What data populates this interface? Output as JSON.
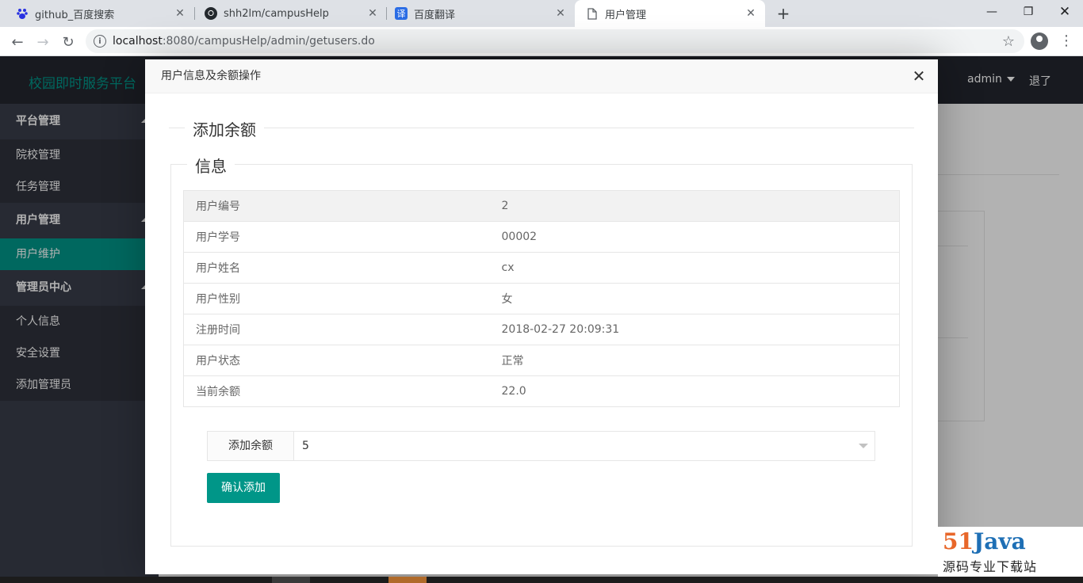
{
  "browser": {
    "tabs": [
      {
        "label": "github_百度搜索",
        "icon": "baidu-paw-icon"
      },
      {
        "label": "shh2lm/campusHelp",
        "icon": "github-icon"
      },
      {
        "label": "百度翻译",
        "icon": "translate-icon",
        "icon_text": "译"
      },
      {
        "label": "用户管理",
        "icon": "page-icon",
        "active": true
      }
    ],
    "url_host": "localhost",
    "url_rest": ":8080/campusHelp/admin/getusers.do"
  },
  "app": {
    "brand": "校园即时服务平台",
    "user": "admin",
    "logout": "退了",
    "sidebar": {
      "groups": [
        {
          "label": "平台管理",
          "items": [
            "院校管理",
            "任务管理"
          ]
        },
        {
          "label": "用户管理",
          "items": [
            "用户维护"
          ]
        },
        {
          "label": "管理员中心",
          "items": [
            "个人信息",
            "安全设置",
            "添加管理员"
          ]
        }
      ],
      "active_item": "用户维护"
    }
  },
  "modal": {
    "title": "用户信息及余额操作",
    "section_title": "添加余额",
    "fieldset_title": "信息",
    "rows": [
      {
        "key": "用户编号",
        "value": "2"
      },
      {
        "key": "用户学号",
        "value": "00002"
      },
      {
        "key": "用户姓名",
        "value": "cx"
      },
      {
        "key": "用户性别",
        "value": "女"
      },
      {
        "key": "注册时间",
        "value": "2018-02-27 20:09:31"
      },
      {
        "key": "用户状态",
        "value": "正常"
      },
      {
        "key": "当前余额",
        "value": "22.0"
      }
    ],
    "form": {
      "label": "添加余额",
      "selected": "5",
      "submit": "确认添加"
    }
  },
  "watermark": {
    "number": "51",
    "word": "Java",
    "subtitle": "源码专业下载站"
  },
  "colors": {
    "accent": "#009688",
    "header": "#23262e",
    "sidebar": "#393d49"
  }
}
